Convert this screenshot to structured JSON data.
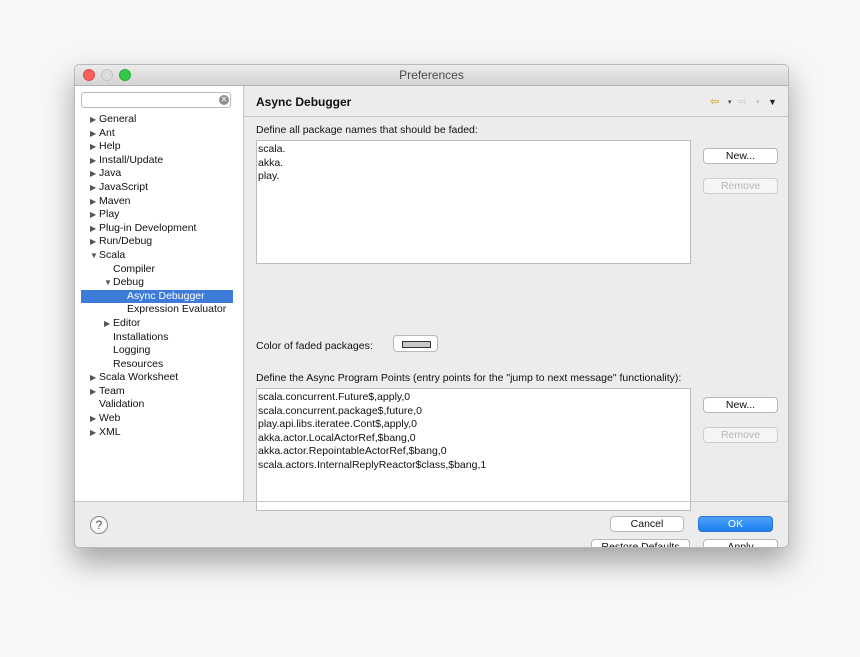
{
  "window": {
    "title": "Preferences"
  },
  "sidebar": {
    "search": {
      "value": "",
      "placeholder": ""
    },
    "items": [
      {
        "label": "General",
        "arrow": "▶",
        "indent": 0
      },
      {
        "label": "Ant",
        "arrow": "▶",
        "indent": 0
      },
      {
        "label": "Help",
        "arrow": "▶",
        "indent": 0
      },
      {
        "label": "Install/Update",
        "arrow": "▶",
        "indent": 0
      },
      {
        "label": "Java",
        "arrow": "▶",
        "indent": 0
      },
      {
        "label": "JavaScript",
        "arrow": "▶",
        "indent": 0
      },
      {
        "label": "Maven",
        "arrow": "▶",
        "indent": 0
      },
      {
        "label": "Play",
        "arrow": "▶",
        "indent": 0
      },
      {
        "label": "Plug-in Development",
        "arrow": "▶",
        "indent": 0
      },
      {
        "label": "Run/Debug",
        "arrow": "▶",
        "indent": 0
      },
      {
        "label": "Scala",
        "arrow": "▼",
        "indent": 0
      },
      {
        "label": "Compiler",
        "arrow": "",
        "indent": 1
      },
      {
        "label": "Debug",
        "arrow": "▼",
        "indent": 1
      },
      {
        "label": "Async Debugger",
        "arrow": "",
        "indent": 2,
        "selected": true
      },
      {
        "label": "Expression Evaluator",
        "arrow": "",
        "indent": 2
      },
      {
        "label": "Editor",
        "arrow": "▶",
        "indent": 1
      },
      {
        "label": "Installations",
        "arrow": "",
        "indent": 1
      },
      {
        "label": "Logging",
        "arrow": "",
        "indent": 1
      },
      {
        "label": "Resources",
        "arrow": "",
        "indent": 1
      },
      {
        "label": "Scala Worksheet",
        "arrow": "▶",
        "indent": 0
      },
      {
        "label": "Team",
        "arrow": "▶",
        "indent": 0
      },
      {
        "label": "Validation",
        "arrow": "",
        "indent": 0
      },
      {
        "label": "Web",
        "arrow": "▶",
        "indent": 0
      },
      {
        "label": "XML",
        "arrow": "▶",
        "indent": 0
      }
    ]
  },
  "panel": {
    "title": "Async Debugger",
    "nav": {
      "back": "⇦",
      "forward": "⇨",
      "dropdown": "▾",
      "menu": "▼"
    },
    "faded": {
      "label": "Define all package names that should be faded:",
      "items": [
        "scala.",
        "akka.",
        "play."
      ],
      "new_label": "New...",
      "remove_label": "Remove"
    },
    "color": {
      "label": "Color of faded packages:",
      "swatch": "#c8c8c8"
    },
    "points": {
      "label": "Define the Async Program Points (entry points for the \"jump to next message\" functionality):",
      "items": [
        "scala.concurrent.Future$,apply,0",
        "scala.concurrent.package$,future,0",
        "play.api.libs.iteratee.Cont$,apply,0",
        "akka.actor.LocalActorRef,$bang,0",
        "akka.actor.RepointableActorRef,$bang,0",
        "scala.actors.InternalReplyReactor$class,$bang,1"
      ],
      "new_label": "New...",
      "remove_label": "Remove"
    },
    "restore_label": "Restore Defaults",
    "apply_label": "Apply"
  },
  "footer": {
    "help": "?",
    "cancel_label": "Cancel",
    "ok_label": "OK"
  },
  "colors": {
    "accent": "#1a7ef0",
    "selection": "#3d7bd9"
  }
}
